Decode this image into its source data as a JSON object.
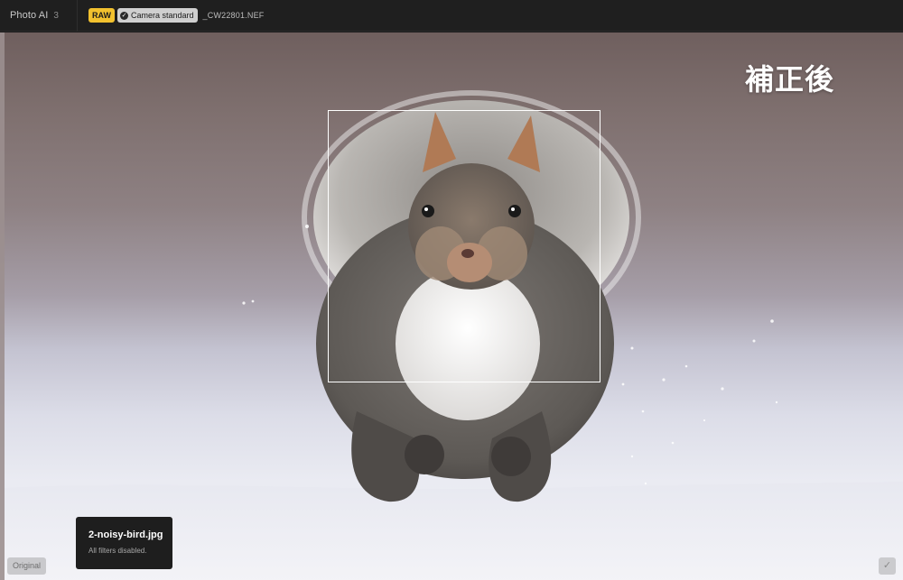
{
  "app": {
    "name": "Photo AI",
    "version": "3"
  },
  "file": {
    "raw_badge": "RAW",
    "profile_badge": "Camera standard",
    "profile_icon": "check-circle-icon",
    "filename": "_CW22801.NEF"
  },
  "canvas": {
    "overlay_label": "補正後",
    "subject_image": "gray squirrel running on snow"
  },
  "toast": {
    "title": "2-noisy-bird.jpg",
    "message": "All filters disabled."
  },
  "controls": {
    "original_label": "Original",
    "confirm_icon": "checkmark-icon",
    "confirm_glyph": "✓"
  },
  "colors": {
    "raw_badge": "#f2c12e",
    "profile_badge": "#cfcfcf",
    "topbar": "#1f1f1f",
    "frame": "#ffffff"
  }
}
